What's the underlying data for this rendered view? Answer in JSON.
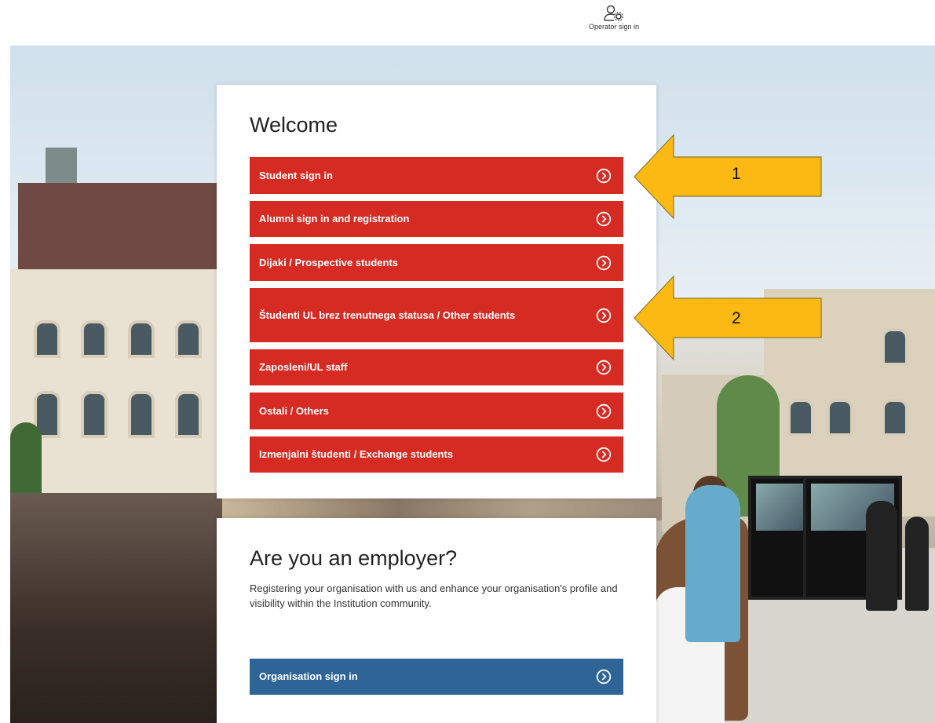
{
  "header": {
    "operator_label": "Operator sign in",
    "operator_icon": "user-gear-icon"
  },
  "welcome": {
    "title": "Welcome",
    "buttons": [
      {
        "label": "Student sign in"
      },
      {
        "label": "Alumni sign in and registration"
      },
      {
        "label": "Dijaki / Prospective students"
      },
      {
        "label": "Študenti UL brez trenutnega statusa / Other students"
      },
      {
        "label": "Zaposleni/UL staff"
      },
      {
        "label": "Ostali / Others"
      },
      {
        "label": "Izmenjalni študenti / Exchange students"
      }
    ],
    "button_icon": "circle-chevron-right-icon"
  },
  "employer": {
    "title": "Are you an employer?",
    "description": "Registering your organisation with us and enhance your organisation's profile and visibility within the Institution community.",
    "button_label": "Organisation sign in"
  },
  "annotations": [
    {
      "number": "1"
    },
    {
      "number": "2"
    }
  ],
  "colors": {
    "primary_red": "#d52b23",
    "org_blue": "#2e6496",
    "annotation_yellow": "#fdb913"
  }
}
